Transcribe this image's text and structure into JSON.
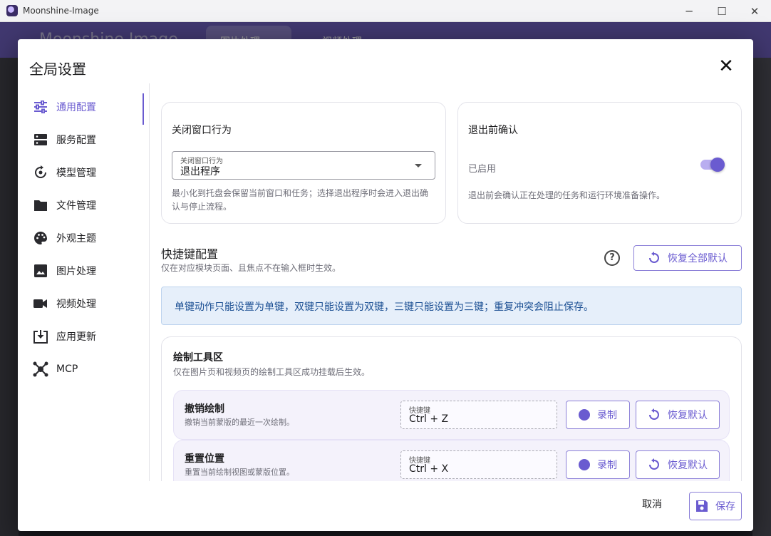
{
  "window": {
    "title": "Moonshine-Image",
    "minimize_icon": "minimize-icon",
    "maximize_icon": "maximize-icon",
    "close_icon": "close-icon"
  },
  "background_app": {
    "brand": "Moonshine Image",
    "tabs": [
      "图片处理",
      "视频处理"
    ]
  },
  "dialog": {
    "title": "全局设置",
    "close_symbol": "✕"
  },
  "sidebar": {
    "items": [
      {
        "label": "通用配置",
        "icon": "sliders-icon",
        "active": true
      },
      {
        "label": "服务配置",
        "icon": "server-icon",
        "active": false
      },
      {
        "label": "模型管理",
        "icon": "model-sync-icon",
        "active": false
      },
      {
        "label": "文件管理",
        "icon": "folder-icon",
        "active": false
      },
      {
        "label": "外观主题",
        "icon": "palette-icon",
        "active": false
      },
      {
        "label": "图片处理",
        "icon": "image-icon",
        "active": false
      },
      {
        "label": "视频处理",
        "icon": "video-icon",
        "active": false
      },
      {
        "label": "应用更新",
        "icon": "update-download-icon",
        "active": false
      },
      {
        "label": "MCP",
        "icon": "hub-icon",
        "active": false
      }
    ]
  },
  "general": {
    "close_behavior": {
      "title": "关闭窗口行为",
      "field_label": "关闭窗口行为",
      "value": "退出程序",
      "help": "最小化到托盘会保留当前窗口和任务；选择退出程序时会进入退出确认与停止流程。"
    },
    "exit_confirm": {
      "title": "退出前确认",
      "status": "已启用",
      "enabled": true,
      "help": "退出前会确认正在处理的任务和运行环境准备操作。"
    }
  },
  "shortcuts": {
    "title": "快捷键配置",
    "subtitle": "仅在对应模块页面、且焦点不在输入框时生效。",
    "help_symbol": "?",
    "reset_all_label": "恢复全部默认",
    "banner": "单键动作只能设置为单键，双键只能设置为双键，三键只能设置为三键；重复冲突会阻止保存。",
    "group": {
      "title": "绘制工具区",
      "subtitle": "仅在图片页和视频页的绘制工具区成功挂载后生效。",
      "rows": [
        {
          "title": "撤销绘制",
          "desc": "撤销当前蒙版的最近一次绘制。",
          "hotkey_label": "快捷键",
          "hotkey": "Ctrl + Z",
          "record_label": "录制",
          "reset_label": "恢复默认"
        },
        {
          "title": "重置位置",
          "desc": "重置当前绘制视图或蒙版位置。",
          "hotkey_label": "快捷键",
          "hotkey": "Ctrl + X",
          "record_label": "录制",
          "reset_label": "恢复默认"
        }
      ]
    }
  },
  "footer": {
    "cancel_label": "取消",
    "save_label": "保存"
  },
  "colors": {
    "accent": "#6a5bd0",
    "info_bg": "#e6effa",
    "info_text": "#1b4f93"
  }
}
